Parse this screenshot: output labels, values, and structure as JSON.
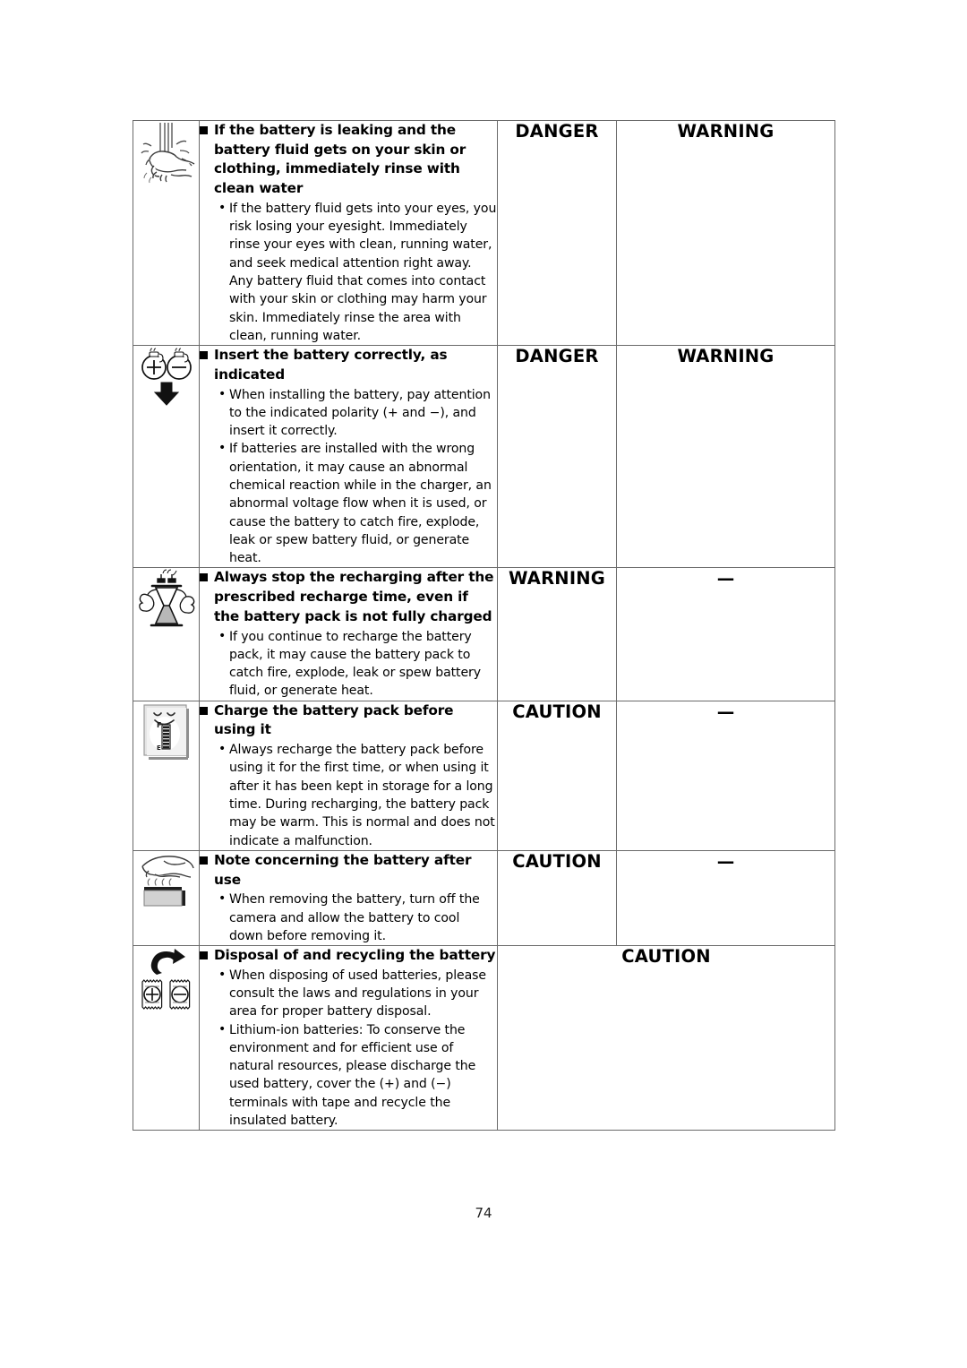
{
  "page": {
    "number": "74"
  },
  "table": {
    "columns": [
      "icon",
      "instruction",
      "danger_level",
      "warning_level"
    ],
    "rows": [
      {
        "icon_name": "rinse-hand-under-water-icon",
        "heading": "If the battery is leaking and the battery fluid gets on your skin or clothing, immediately rinse with clean water",
        "points": [
          "If the battery fluid gets into your eyes, you risk losing your eyesight. Immediately rinse your eyes with clean, running water, and seek medical attention right away. Any battery fluid that comes into contact with your skin or clothing may harm your skin. Immediately rinse the area with clean, running water."
        ],
        "col3": "DANGER",
        "col4": "WARNING"
      },
      {
        "icon_name": "battery-polarity-insert-icon",
        "heading": "Insert the battery correctly, as indicated",
        "points": [
          "When installing the battery, pay attention to the indicated polarity (+ and −), and insert it correctly.",
          "If batteries are installed with the wrong orientation, it may cause an abnormal chemical reaction while in the charger, an abnormal voltage flow when it is used, or cause the battery to catch fire, explode, leak or spew battery fluid, or generate heat."
        ],
        "col3": "DANGER",
        "col4": "WARNING"
      },
      {
        "icon_name": "hourglass-stop-icon",
        "heading": "Always stop the recharging after the prescribed recharge time, even if the battery pack is not fully charged",
        "points": [
          "If you continue to recharge the battery pack, it may cause the battery pack to catch fire, explode, leak or spew battery fluid, or generate heat."
        ],
        "col3": "WARNING",
        "col4": "—"
      },
      {
        "icon_name": "battery-charge-gauge-icon",
        "heading": "Charge the battery pack before using it",
        "points": [
          "Always recharge the battery pack before using it for the first time, or when using it after it has been kept in storage for a long time. During recharging, the battery pack may be warm. This is normal and does not indicate a malfunction."
        ],
        "col3": "CAUTION",
        "col4": "—"
      },
      {
        "icon_name": "hot-battery-hand-icon",
        "heading": "Note concerning the battery after use",
        "points": [
          "When removing the battery, turn off the camera and allow the battery to cool down before removing it."
        ],
        "col3": "CAUTION",
        "col4": "—",
        "merged_col3_col4_split": "wide-caution"
      },
      {
        "icon_name": "battery-recycle-terminals-icon",
        "heading": "Disposal of and recycling the battery",
        "points": [
          "When disposing of used batteries, please consult the laws and regulations in your area for proper battery disposal.",
          "Lithium-ion batteries: To conserve the environment and for efficient use of natural resources, please discharge the used battery, cover the (+) and (−) terminals with tape and recycle the insulated battery."
        ],
        "col3": "CAUTION",
        "col4": "",
        "merged_col3_col4_split": "full-merge"
      }
    ]
  },
  "colors": {
    "border": "#6a6a6a",
    "text": "#000000",
    "page_number": "#1f1f1f"
  }
}
